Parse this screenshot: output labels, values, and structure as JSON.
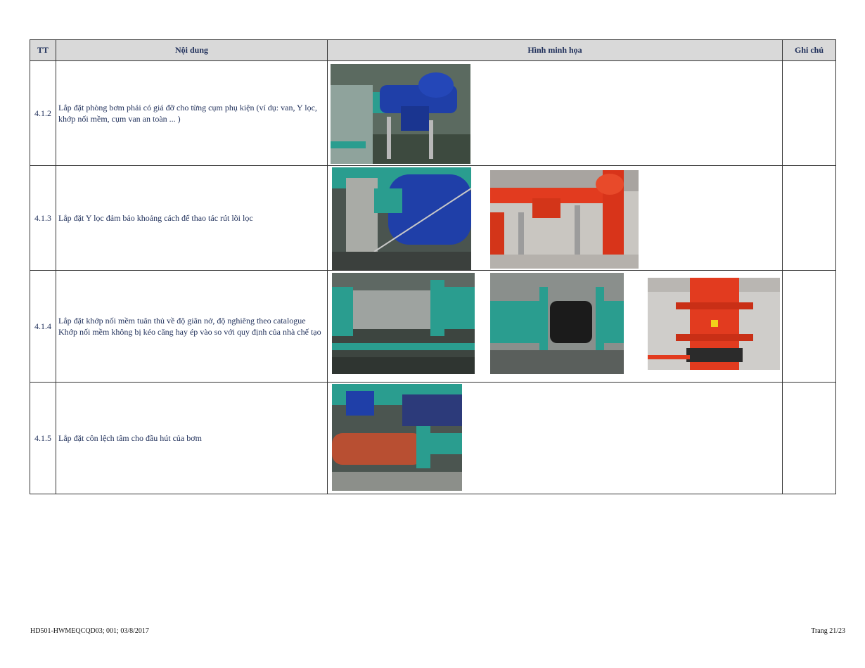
{
  "table": {
    "headers": {
      "tt": "TT",
      "content": "Nội dung",
      "images": "Hình minh họa",
      "note": "Ghi chú"
    },
    "rows": [
      {
        "tt": "4.1.2",
        "content": "Lắp đặt phòng bơm phải có giá đỡ cho từng cụm phụ kiện (ví dụ: van, Y lọc, khớp nối mềm, cụm van an toàn ... )",
        "note": ""
      },
      {
        "tt": "4.1.3",
        "content": "Lắp đặt Y lọc đảm bảo khoảng cách để thao tác rút lõi lọc",
        "note": ""
      },
      {
        "tt": "4.1.4",
        "content_line1": "Lắp đặt khớp nối mềm tuân thủ về độ giãn nở, độ nghiêng theo catalogue",
        "content_line2": " Khớp nối mềm không bị kéo căng hay ép vào so với quy định của nhà chế tạo",
        "note": ""
      },
      {
        "tt": "4.1.5",
        "content": "Lắp đặt côn lệch tâm cho đầu hút của bơm",
        "note": ""
      }
    ]
  },
  "footer": {
    "doc_code": "HD501-HWMEQCQD03; 001; 03/8/2017",
    "page": "Trang 21/23"
  }
}
